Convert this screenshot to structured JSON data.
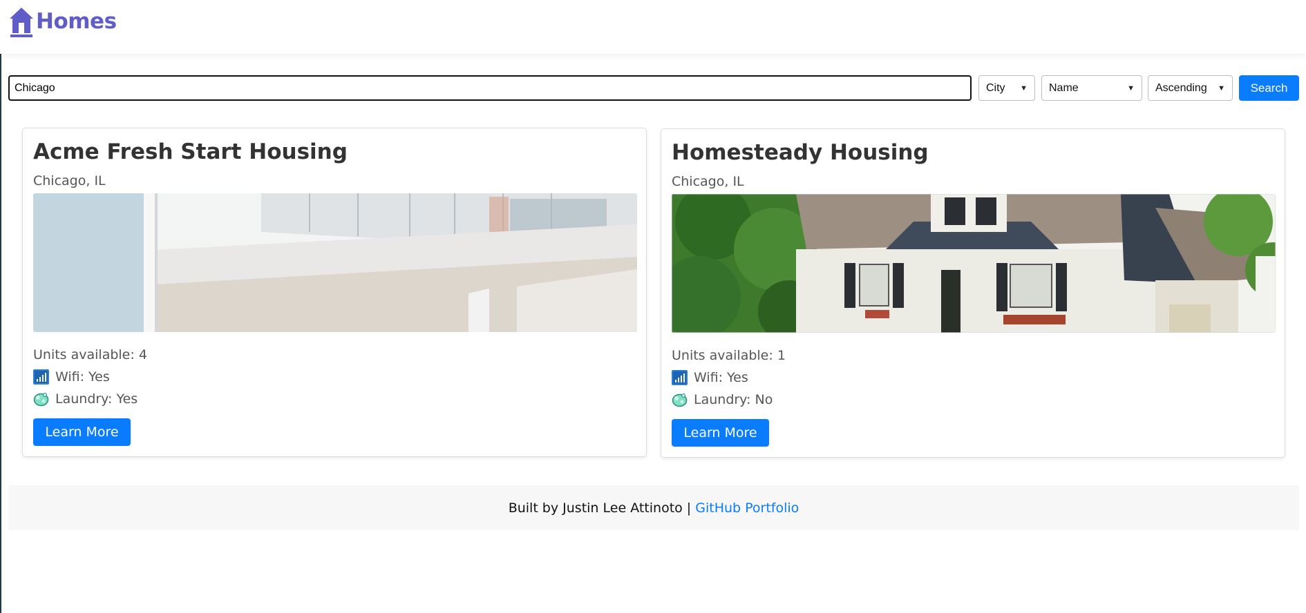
{
  "header": {
    "brand": "Homes",
    "brand_icon": "house-icon",
    "brand_color": "#605dc8"
  },
  "search": {
    "value": "Chicago",
    "filter_by": "City",
    "sort_by": "Name",
    "order": "Ascending",
    "button_label": "Search"
  },
  "listings": [
    {
      "title": "Acme Fresh Start Housing",
      "location": "Chicago, IL",
      "image": "modern-white-apartment-building-photo",
      "units_label": "Units available: 4",
      "wifi_label": "Wifi: Yes",
      "laundry_label": "Laundry: Yes",
      "button_label": "Learn More"
    },
    {
      "title": "Homesteady Housing",
      "location": "Chicago, IL",
      "image": "suburban-house-photo",
      "units_label": "Units available: 1",
      "wifi_label": "Wifi: Yes",
      "laundry_label": "Laundry: No",
      "button_label": "Learn More"
    }
  ],
  "footer": {
    "text": "Built by Justin Lee Attinoto | ",
    "link_label": "GitHub Portfolio"
  },
  "colors": {
    "accent": "#0a7cff",
    "footer_bg": "#f7f7f7"
  }
}
